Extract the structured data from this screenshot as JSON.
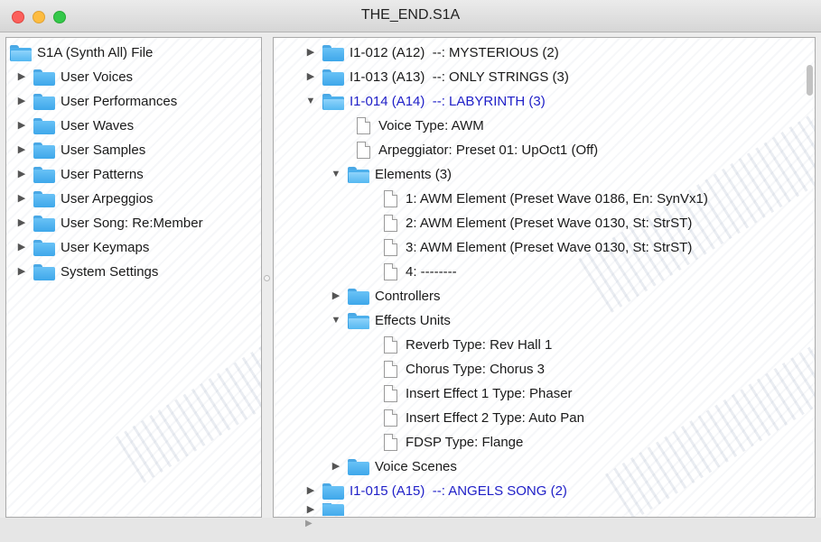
{
  "window": {
    "title": "THE_END.S1A"
  },
  "left_tree": {
    "root": "S1A (Synth All) File",
    "items": [
      "User Voices",
      "User Performances",
      "User Waves",
      "User Samples",
      "User Patterns",
      "User Arpeggios",
      "User Song: Re:Member",
      "User Keymaps",
      "System Settings"
    ]
  },
  "right_tree": {
    "voice_012": "I1-012 (A12)  --: MYSTERIOUS (2)",
    "voice_013": "I1-013 (A13)  --: ONLY STRINGS (3)",
    "voice_014": "I1-014 (A14)  --: LABYRINTH (3)",
    "voice_type": "Voice Type: AWM",
    "arpeggiator": "Arpeggiator: Preset 01: UpOct1 (Off)",
    "elements": "Elements (3)",
    "element_items": [
      "1: AWM Element (Preset Wave 0186, En: SynVx1)",
      "2: AWM Element (Preset Wave 0130, St: StrST)",
      "3: AWM Element (Preset Wave 0130, St: StrST)",
      "4: --------"
    ],
    "controllers": "Controllers",
    "effects_units": "Effects Units",
    "effect_items": [
      "Reverb Type: Rev Hall 1",
      "Chorus Type: Chorus 3",
      "Insert Effect 1 Type: Phaser",
      "Insert Effect 2 Type: Auto Pan",
      "FDSP Type: Flange"
    ],
    "voice_scenes": "Voice Scenes",
    "voice_015": "I1-015 (A15)  --: ANGELS SONG (2)"
  },
  "colors": {
    "selected_text": "#2020c8",
    "folder": "#3ea7ea"
  },
  "icons": {
    "collapsed": "triangle-right-icon",
    "expanded": "triangle-down-icon",
    "folder": "folder-icon",
    "document": "document-icon"
  }
}
